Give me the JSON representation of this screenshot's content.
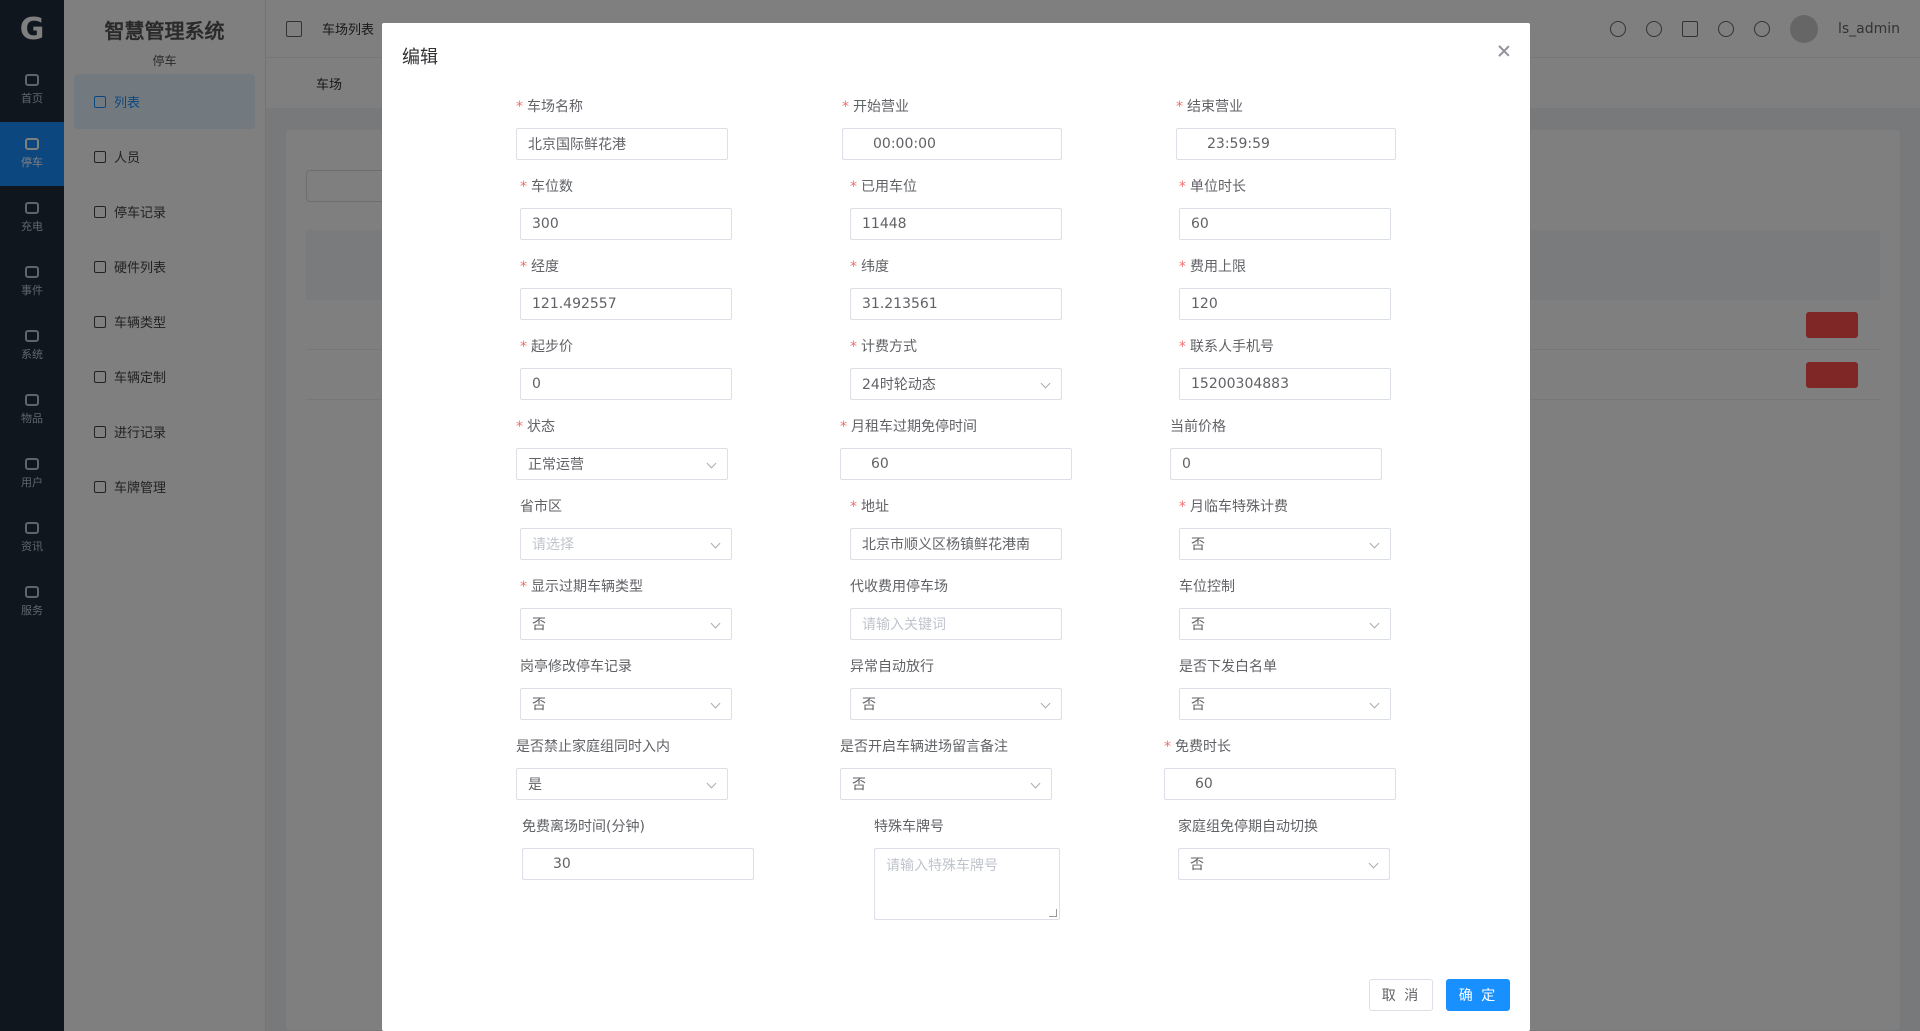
{
  "app": {
    "system_title": "智慧管理系统",
    "system_subtitle": "停车",
    "breadcrumb": "车场列表",
    "current_tab": "车场",
    "user_name": "ls_admin"
  },
  "nav": [
    "首页",
    "停车",
    "充电",
    "事件",
    "系统",
    "物品",
    "用户",
    "资讯",
    "服务"
  ],
  "menu": [
    "列表",
    "人员",
    "停车记录",
    "硬件列表",
    "车辆类型",
    "车辆定制",
    "进行记录",
    "车牌管理"
  ],
  "dialog": {
    "title": "编辑",
    "cancel_label": "取 消",
    "confirm_label": "确 定"
  },
  "fields": {
    "parking_name": {
      "label": "车场名称",
      "value": "北京国际鲜花港"
    },
    "open_time": {
      "label": "开始营业",
      "value": "00:00:00"
    },
    "close_time": {
      "label": "结束营业",
      "value": "23:59:59"
    },
    "spaces": {
      "label": "车位数",
      "value": "300"
    },
    "used_spaces": {
      "label": "已用车位",
      "value": "11448"
    },
    "unit_duration": {
      "label": "单位时长",
      "value": "60"
    },
    "longitude": {
      "label": "经度",
      "value": "121.492557"
    },
    "latitude": {
      "label": "纬度",
      "value": "31.213561"
    },
    "fee_cap": {
      "label": "费用上限",
      "value": "120"
    },
    "start_price": {
      "label": "起步价",
      "value": "0"
    },
    "billing_mode": {
      "label": "计费方式",
      "value": "24时轮动态"
    },
    "contact_phone": {
      "label": "联系人手机号",
      "value": "15200304883"
    },
    "status": {
      "label": "状态",
      "value": "正常运营"
    },
    "monthly_free_time": {
      "label": "月租车过期免停时间",
      "value": "60"
    },
    "current_price": {
      "label": "当前价格",
      "value": "0"
    },
    "region": {
      "label": "省市区",
      "placeholder": "请选择"
    },
    "address": {
      "label": "地址",
      "value": "北京市顺义区杨镇鲜花港南"
    },
    "monthly_special_fee": {
      "label": "月临车特殊计费",
      "value": "否"
    },
    "show_expired_type": {
      "label": "显示过期车辆类型",
      "value": "否"
    },
    "collect_fee_lot": {
      "label": "代收费用停车场",
      "placeholder": "请输入关键词"
    },
    "space_control": {
      "label": "车位控制",
      "value": "否"
    },
    "booth_edit_record": {
      "label": "岗亭修改停车记录",
      "value": "否"
    },
    "auto_release": {
      "label": "异常自动放行",
      "value": "否"
    },
    "whitelist": {
      "label": "是否下发白名单",
      "value": "否"
    },
    "family_forbid": {
      "label": "是否禁止家庭组同时入内",
      "value": "是"
    },
    "entry_remark": {
      "label": "是否开启车辆进场留言备注",
      "value": "否"
    },
    "free_duration": {
      "label": "免费时长",
      "value": "60"
    },
    "free_leave_minutes": {
      "label": "免费离场时间(分钟)",
      "value": "30"
    },
    "special_plate": {
      "label": "特殊车牌号",
      "placeholder": "请输入特殊车牌号"
    },
    "family_auto_switch": {
      "label": "家庭组免停期自动切换",
      "value": "否"
    }
  }
}
